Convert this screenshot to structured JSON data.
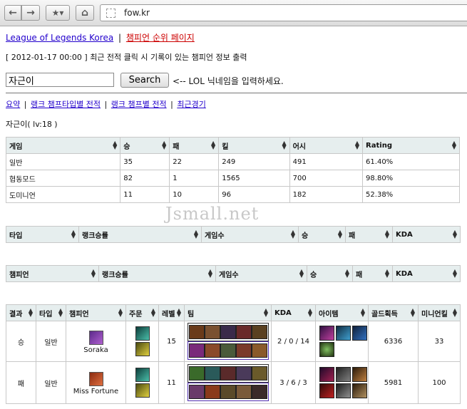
{
  "browser": {
    "url": "fow.kr"
  },
  "nav": {
    "site_link": "League of Legends Korea",
    "separator": "|",
    "champ_rank_link": "챔피언 순위 페이지"
  },
  "notice": "[ 2012-01-17 00:00 ] 최근 전적 클릭 시 기록이 있는 챔피언 정보 출력",
  "search": {
    "value": "자근이",
    "button": "Search",
    "hint": "<-- LOL 닉네임을 입력하세요."
  },
  "tabs": {
    "summary": "요약",
    "sep1": "|",
    "rank_type": "랭크 챔프타입별 전적",
    "sep2": "|",
    "rank_champ": "랭크 챔프별 전적",
    "sep3": "|",
    "recent": "최근경기"
  },
  "player": "자근이( lv:18 )",
  "stats_table": {
    "headers": [
      "게임",
      "승",
      "패",
      "킬",
      "어시",
      "Rating"
    ],
    "rows": [
      [
        "일반",
        "35",
        "22",
        "249",
        "491",
        "61.40%"
      ],
      [
        "협동모드",
        "82",
        "1",
        "1565",
        "700",
        "98.80%"
      ],
      [
        "도미니언",
        "11",
        "10",
        "96",
        "182",
        "52.38%"
      ]
    ]
  },
  "watermark": "Jsmall.net",
  "type_table": {
    "headers": [
      "타입",
      "랭크승률",
      "게임수",
      "승",
      "패",
      "KDA"
    ]
  },
  "champ_table": {
    "headers": [
      "챔피언",
      "랭크승률",
      "게임수",
      "승",
      "패",
      "KDA"
    ]
  },
  "recent_table": {
    "headers": [
      "결과",
      "타입",
      "챔피언",
      "주문",
      "레벨",
      "팀",
      "KDA",
      "아이템",
      "골드획득",
      "미니언킬"
    ],
    "rows": [
      {
        "result": "승",
        "type": "일반",
        "champion": "Soraka",
        "level": "15",
        "kda": "2 / 0 / 14",
        "gold": "6336",
        "minions": "33"
      },
      {
        "result": "패",
        "type": "일반",
        "champion": "Miss Fortune",
        "level": "11",
        "kda": "3 / 6 / 3",
        "gold": "5981",
        "minions": "100"
      }
    ]
  },
  "colors": {
    "link": "#2200cc",
    "link_red": "#cc0000",
    "header_bg": "#e6eeee"
  }
}
